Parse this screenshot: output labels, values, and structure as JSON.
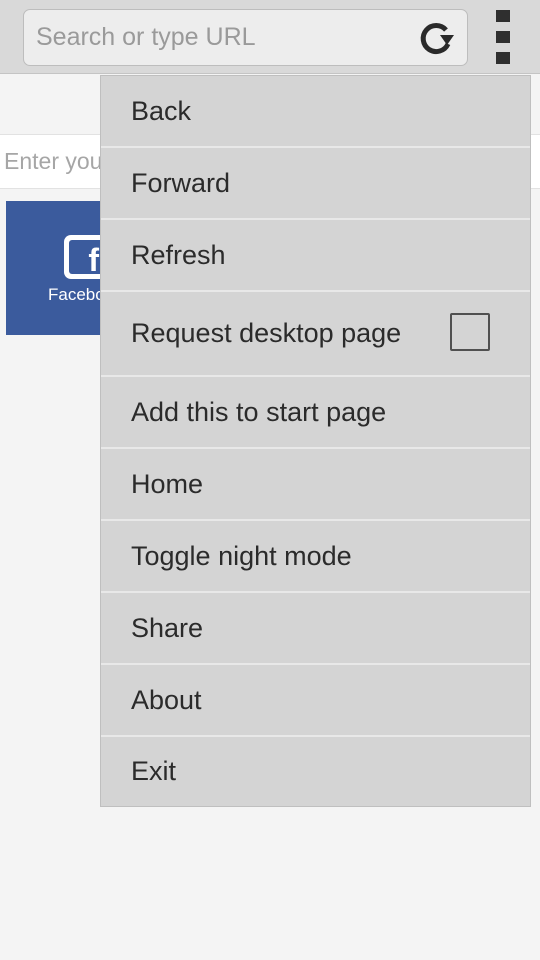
{
  "toolbar": {
    "url_placeholder": "Search or type URL",
    "reload_icon": "reload-icon",
    "overflow_icon": "overflow-menu-icon"
  },
  "page": {
    "input_placeholder_visible": "Enter you",
    "tile": {
      "label_visible": "Facebo",
      "icon": "facebook-icon",
      "icon_glyph": "f",
      "color": "#3b5b9d"
    }
  },
  "menu": {
    "items": [
      {
        "label": "Back"
      },
      {
        "label": "Forward"
      },
      {
        "label": "Refresh"
      },
      {
        "label": "Request desktop page",
        "checked": false
      },
      {
        "label": "Add this to start page"
      },
      {
        "label": "Home"
      },
      {
        "label": "Toggle night mode"
      },
      {
        "label": "Share"
      },
      {
        "label": "About"
      },
      {
        "label": "Exit"
      }
    ]
  }
}
